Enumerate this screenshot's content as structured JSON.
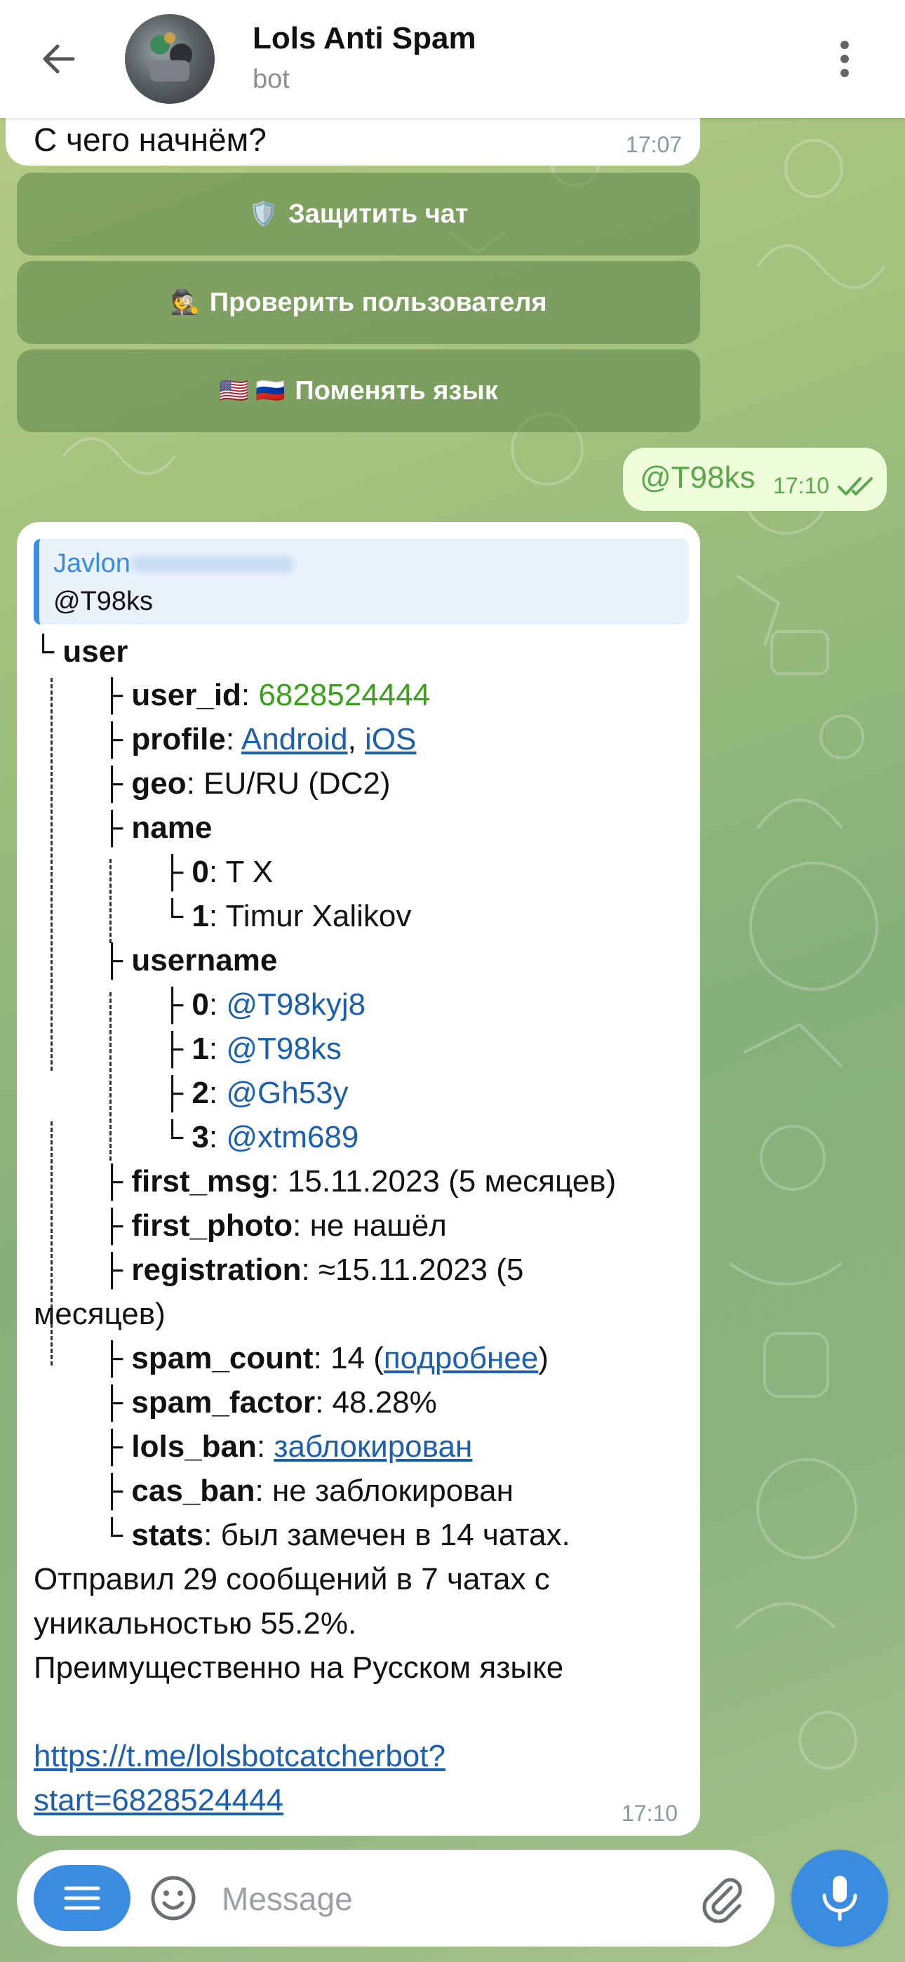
{
  "header": {
    "title": "Lols Anti Spam",
    "subtitle": "bot"
  },
  "messages": {
    "prompt_text": "С чего начнём?",
    "prompt_time": "17:07",
    "keyboard": [
      {
        "emoji": "🛡️",
        "label": "Защитить чат"
      },
      {
        "emoji": "🕵️",
        "label": "Проверить пользователя"
      },
      {
        "emoji": "🇺🇸 🇷🇺",
        "label": "Поменять язык"
      }
    ],
    "outgoing_text": "@T98ks",
    "outgoing_time": "17:10"
  },
  "card": {
    "quote_name": "Javlon",
    "quote_username": "@T98ks",
    "time": "17:10",
    "user_key": "user",
    "user_id_key": "user_id",
    "user_id_value": "6828524444",
    "profile_key": "profile",
    "profile_android": "Android",
    "profile_sep": ",",
    "profile_ios": "iOS",
    "geo_key": "geo",
    "geo_value": "EU/RU (DC2)",
    "name_key": "name",
    "names": [
      {
        "index": "0",
        "value": "T X"
      },
      {
        "index": "1",
        "value": "Timur Xalikov"
      }
    ],
    "username_key": "username",
    "usernames": [
      {
        "index": "0",
        "value": "@T98kyj8"
      },
      {
        "index": "1",
        "value": "@T98ks"
      },
      {
        "index": "2",
        "value": "@Gh53y"
      },
      {
        "index": "3",
        "value": "@xtm689"
      }
    ],
    "first_msg_key": "first_msg",
    "first_msg_value": "15.11.2023 (5 месяцев)",
    "first_photo_key": "first_photo",
    "first_photo_value": "не нашёл",
    "registration_key": "registration",
    "registration_value": "≈15.11.2023 (5",
    "registration_cont": "месяцев)",
    "spam_count_key": "spam_count",
    "spam_count_value": "14 (",
    "spam_count_link": "подробнее",
    "spam_count_close": ")",
    "spam_factor_key": "spam_factor",
    "spam_factor_value": "48.28%",
    "lols_ban_key": "lols_ban",
    "lols_ban_value": "заблокирован",
    "cas_ban_key": "cas_ban",
    "cas_ban_value": "не заблокирован",
    "stats_key": "stats",
    "stats_value": "был замечен в 14 чатах.",
    "summary_line1": "Отправил 29 сообщений в 7 чатах с",
    "summary_line2": "уникальностью 55.2%.",
    "summary_line3": "Преимущественно на Русском языке",
    "link_line1": "https://t.me/lolsbotcatcherbot?",
    "link_line2": "start=6828524444"
  },
  "input": {
    "placeholder": "Message"
  },
  "colors": {
    "accent": "#3a8ce0",
    "green_value": "#3aa01c",
    "link": "#1c5fae",
    "outgoing_bubble": "#eefcdc"
  }
}
